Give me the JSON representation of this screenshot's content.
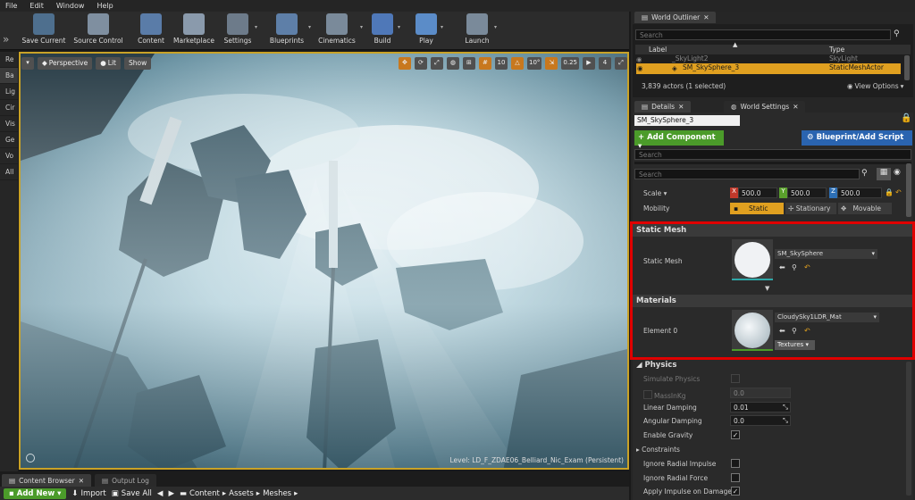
{
  "menu": [
    "File",
    "Edit",
    "Window",
    "Help"
  ],
  "toolbar": [
    {
      "label": "Save Current",
      "icon": "save-icon",
      "dropdown": false
    },
    {
      "label": "Source Control",
      "icon": "source-control-icon",
      "dropdown": false
    },
    {
      "label": "Content",
      "icon": "content-icon",
      "dropdown": false
    },
    {
      "label": "Marketplace",
      "icon": "marketplace-icon",
      "dropdown": false
    },
    {
      "label": "Settings",
      "icon": "settings-icon",
      "dropdown": true
    },
    {
      "label": "Blueprints",
      "icon": "blueprints-icon",
      "dropdown": true
    },
    {
      "label": "Cinematics",
      "icon": "cinematics-icon",
      "dropdown": true
    },
    {
      "label": "Build",
      "icon": "build-icon",
      "dropdown": true
    },
    {
      "label": "Play",
      "icon": "play-icon",
      "dropdown": true
    },
    {
      "label": "Launch",
      "icon": "launch-icon",
      "dropdown": true
    }
  ],
  "left_tabs": [
    "Re",
    "Ba",
    "Lig",
    "Cir",
    "Vis",
    "Ge",
    "Vo",
    "All"
  ],
  "viewport": {
    "perspective": "Perspective",
    "lit": "Lit",
    "show": "Show",
    "grid_snap": "10",
    "rot_snap": "10°",
    "scale_snap": "0.25",
    "camera_speed": "4",
    "level_label": "Level:  LD_F_ZDAE06_Belliard_Nic_Exam (Persistent)"
  },
  "bottom_tabs": [
    "Content Browser",
    "Output Log"
  ],
  "content_browser": {
    "add_new": "Add New",
    "import": "Import",
    "save_all": "Save All",
    "path": [
      "Content",
      "Assets",
      "Meshes"
    ]
  },
  "outliner": {
    "tab": "World Outliner",
    "search_placeholder": "Search",
    "col_label": "Label",
    "col_type": "Type",
    "rows": [
      {
        "label": "_SkyLight2",
        "type": "SkyLight",
        "selected": false
      },
      {
        "label": "SM_SkySphere_3",
        "type": "StaticMeshActor",
        "selected": true
      }
    ],
    "count": "3,839 actors (1 selected)",
    "view_options": "View Options"
  },
  "details": {
    "tab": "Details",
    "tab2": "World Settings",
    "name": "SM_SkySphere_3",
    "add_component": "+ Add Component",
    "blueprint": "Blueprint/Add Script",
    "search_placeholder": "Search",
    "search2_placeholder": "Search",
    "scale_label": "Scale",
    "scale": {
      "x": "500.0",
      "y": "500.0",
      "z": "500.0"
    },
    "mobility_label": "Mobility",
    "mobility": [
      "Static",
      "Stationary",
      "Movable"
    ],
    "static_mesh_section": "Static Mesh",
    "static_mesh_label": "Static Mesh",
    "static_mesh_value": "SM_SkySphere",
    "materials_section": "Materials",
    "element0_label": "Element 0",
    "element0_value": "CloudySky1LDR_Mat",
    "textures": "Textures",
    "physics_section": "Physics",
    "physics": [
      {
        "label": "Simulate Physics",
        "type": "check",
        "checked": false,
        "dim": true
      },
      {
        "label": "MassInKg",
        "type": "num",
        "value": "0.0",
        "dim": true
      },
      {
        "label": "Linear Damping",
        "type": "num",
        "value": "0.01",
        "dim": false
      },
      {
        "label": "Angular Damping",
        "type": "num",
        "value": "0.0",
        "dim": false
      },
      {
        "label": "Enable Gravity",
        "type": "check",
        "checked": true,
        "dim": false
      },
      {
        "label": "Constraints",
        "type": "group",
        "dim": false
      },
      {
        "label": "Ignore Radial Impulse",
        "type": "check",
        "checked": false,
        "dim": false
      },
      {
        "label": "Ignore Radial Force",
        "type": "check",
        "checked": false,
        "dim": false
      },
      {
        "label": "Apply Impulse on Damage",
        "type": "check",
        "checked": true,
        "dim": false
      }
    ]
  },
  "colors": {
    "accent_green": "#4b9b2a",
    "blueprint_blue": "#2a64b0",
    "selection_orange": "#e0a020",
    "highlight_red": "#e00000",
    "viewport_border": "#c9a227"
  }
}
